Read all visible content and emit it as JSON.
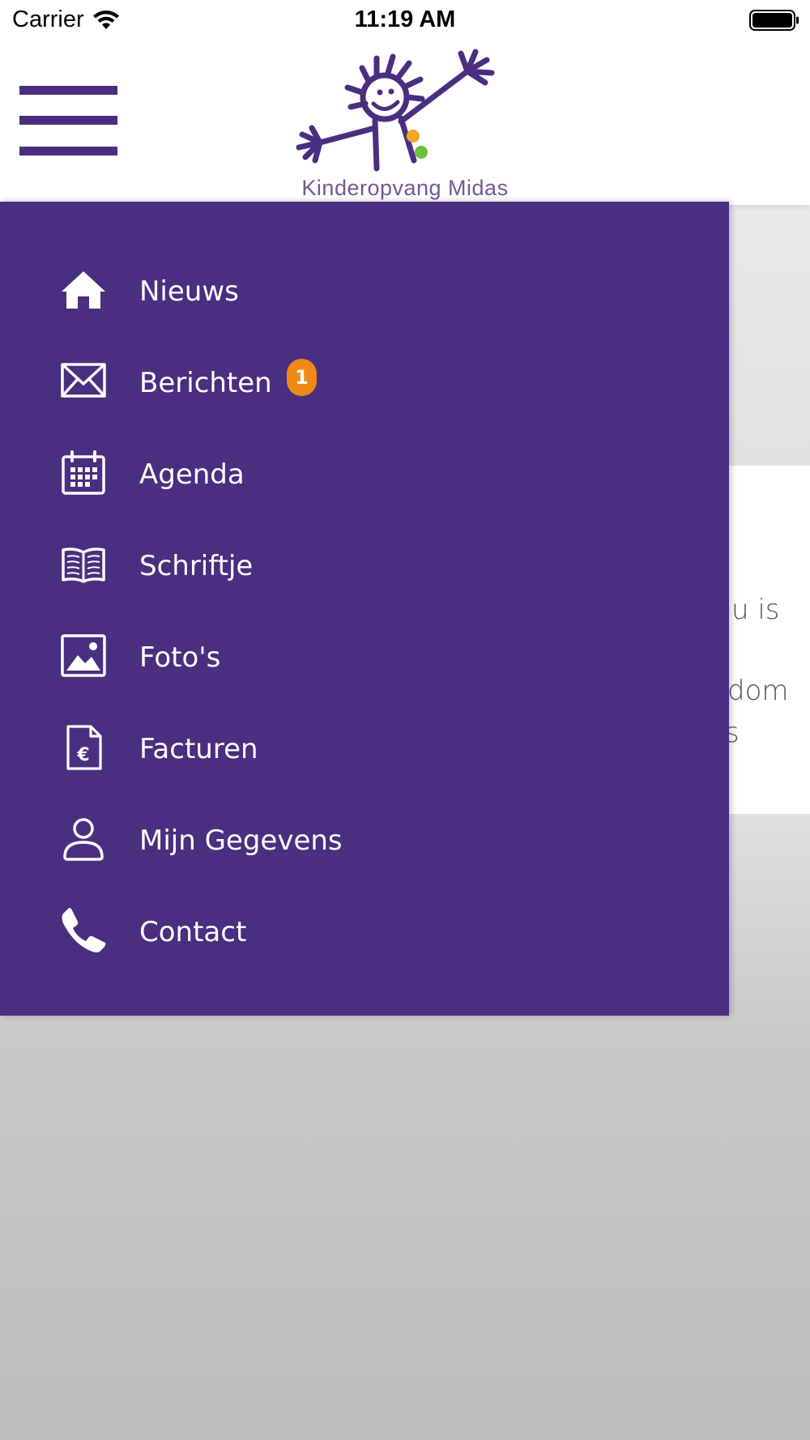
{
  "status_bar": {
    "carrier": "Carrier",
    "time": "11:19 AM"
  },
  "header": {
    "logo_text": "Kinderopvang Midas"
  },
  "background": {
    "line1": "u is",
    "line2": "dom",
    "line3": "s"
  },
  "menu": {
    "items": [
      {
        "label": "Nieuws",
        "icon": "home-icon"
      },
      {
        "label": "Berichten",
        "icon": "envelope-icon",
        "badge": "1"
      },
      {
        "label": "Agenda",
        "icon": "calendar-icon"
      },
      {
        "label": "Schriftje",
        "icon": "book-icon"
      },
      {
        "label": "Foto's",
        "icon": "photo-icon"
      },
      {
        "label": "Facturen",
        "icon": "invoice-euro-icon"
      },
      {
        "label": "Mijn Gegevens",
        "icon": "user-icon"
      },
      {
        "label": "Contact",
        "icon": "phone-icon"
      }
    ]
  },
  "colors": {
    "brand_purple": "#4a2e80",
    "badge_orange": "#f08a16"
  }
}
